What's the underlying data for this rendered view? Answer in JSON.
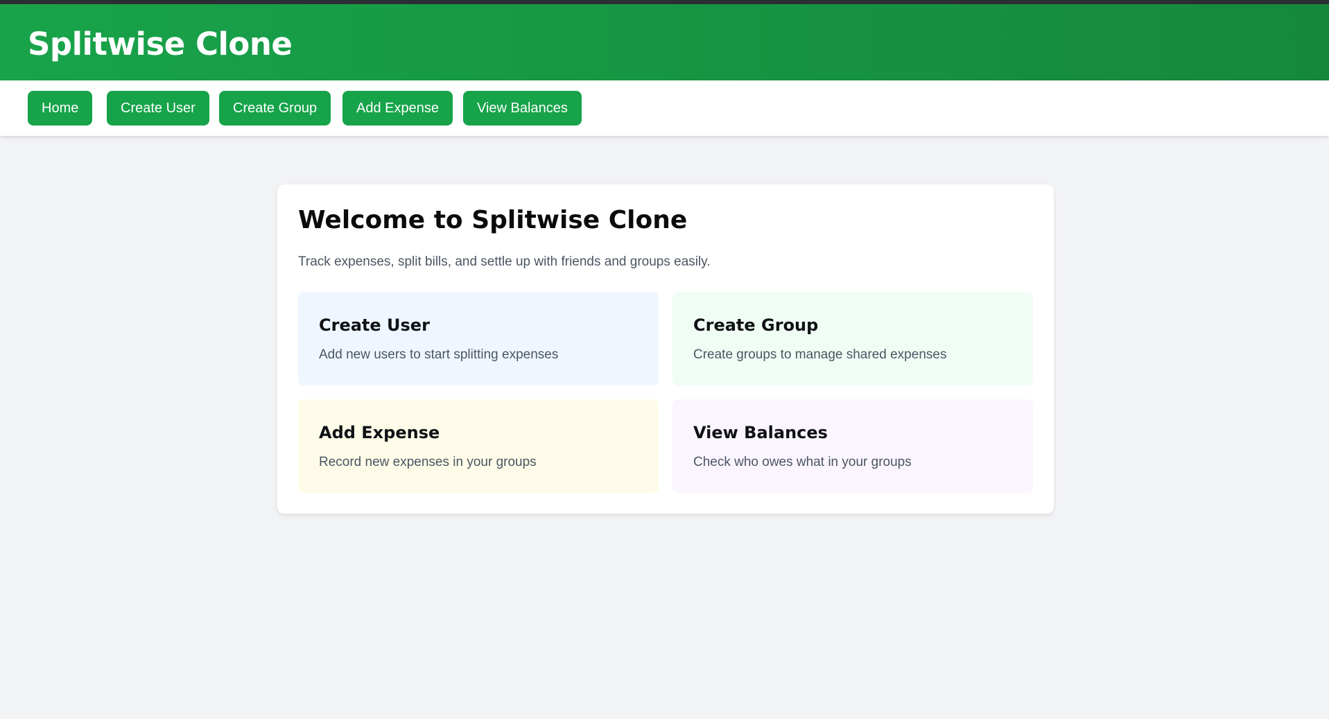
{
  "app": {
    "title": "Splitwise Clone"
  },
  "nav": {
    "items": [
      {
        "label": "Home"
      },
      {
        "label": "Create User"
      },
      {
        "label": "Create Group"
      },
      {
        "label": "Add Expense"
      },
      {
        "label": "View Balances"
      }
    ]
  },
  "home": {
    "title": "Welcome to Splitwise Clone",
    "subtitle": "Track expenses, split bills, and settle up with friends and groups easily.",
    "features": [
      {
        "title": "Create User",
        "description": "Add new users to start splitting expenses",
        "color": "#eff6ff"
      },
      {
        "title": "Create Group",
        "description": "Create groups to manage shared expenses",
        "color": "#f0fdf4"
      },
      {
        "title": "Add Expense",
        "description": "Record new expenses in your groups",
        "color": "#fefce8"
      },
      {
        "title": "View Balances",
        "description": "Check who owes what in your groups",
        "color": "#faf5ff"
      }
    ]
  },
  "colors": {
    "brand": "#16a34a",
    "page_background": "#f2f3f5"
  }
}
